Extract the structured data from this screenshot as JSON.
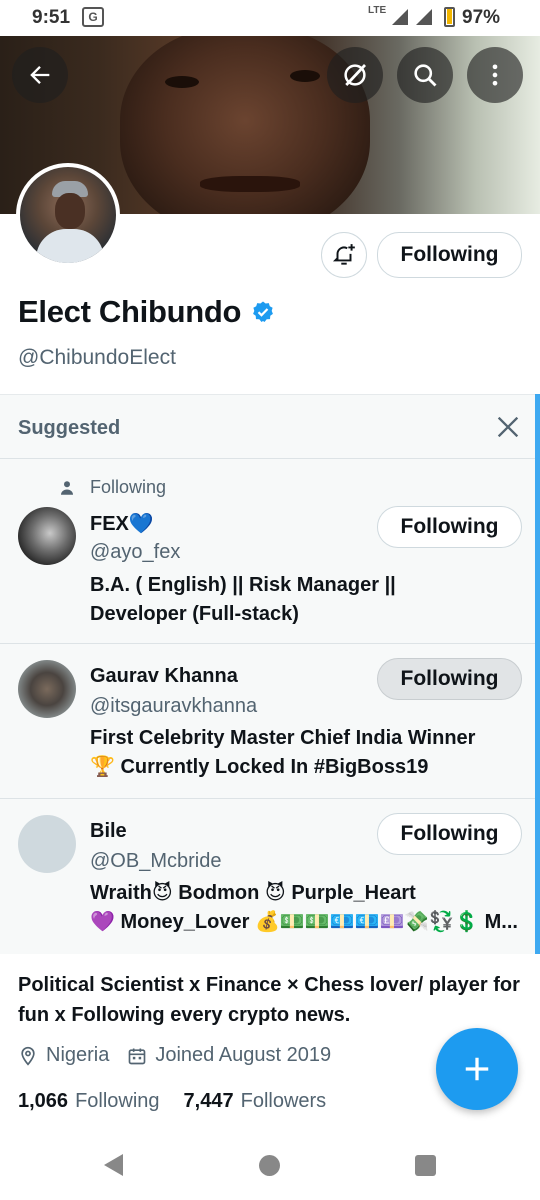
{
  "status_bar": {
    "time": "9:51",
    "network": "LTE",
    "battery": "97%",
    "battery_level": 0.97,
    "notification_icon": "translate-icon"
  },
  "banner_actions": {
    "back_icon": "arrow-left-icon",
    "grok_icon": "grok-icon",
    "search_icon": "search-icon",
    "more_icon": "more-vertical-icon"
  },
  "profile": {
    "name": "Elect Chibundo",
    "handle": "@ChibundoElect",
    "following_button": "Following",
    "bio": "Political Scientist x  Finance ×  Chess lover/ player for fun x  Following every crypto news.",
    "location": "Nigeria",
    "joined": "Joined August 2019",
    "following_count": "1,066",
    "following_label": "Following",
    "followers_count": "7,447",
    "followers_label": "Followers"
  },
  "suggested": {
    "title": "Suggested",
    "users": [
      {
        "context": "Following",
        "name": "FEX💙",
        "handle": "@ayo_fex",
        "bio_line1": "B.A. ( English) || Risk Manager ||",
        "bio_line2": "Developer (Full-stack)",
        "button": "Following"
      },
      {
        "name": "Gaurav Khanna",
        "handle": "@itsgauravkhanna",
        "bio_line1": "First Celebrity Master Chief India Winner",
        "bio_line2": "🏆  Currently Locked In #BigBoss19",
        "button": "Following"
      },
      {
        "name": "Bile",
        "handle": "@OB_Mcbride",
        "bio_line1": "Wraith😈 Bodmon 😈 Purple_Heart",
        "bio_line2": "💜 Money_Lover 💰💵💵💶💶💷💸💱💲 M...",
        "button": "Following"
      }
    ]
  },
  "colors": {
    "accent": "#1d9bf0",
    "text_primary": "#0f1419",
    "text_secondary": "#536471"
  }
}
